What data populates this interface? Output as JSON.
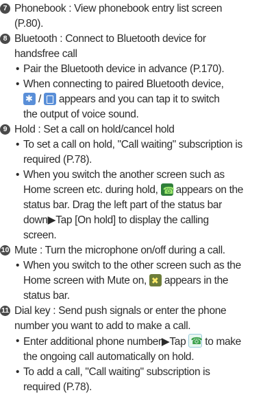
{
  "items": [
    {
      "num": "7",
      "lines": [
        "Phonebook : View phonebook entry list screen",
        "(P.80)."
      ]
    },
    {
      "num": "8",
      "lines": [
        "Bluetooth : Connect to Bluetooth device for",
        "handsfree call"
      ]
    },
    {
      "num": "9",
      "lines": [
        "Hold : Set a call on hold/cancel hold"
      ]
    },
    {
      "num": "10",
      "lines": [
        "Mute : Turn the microphone on/off during a call."
      ]
    },
    {
      "num": "11",
      "lines": [
        "Dial key : Send push signals or enter the phone",
        "number you want to add to make a call."
      ]
    }
  ],
  "bullets": {
    "b1": [
      "Pair the Bluetooth device in advance (P.170)."
    ],
    "b2": [
      "When connecting to paired Bluetooth device,",
      " / ",
      " appears and you can tap it to switch",
      "the output of voice sound."
    ],
    "b3": [
      "To set a call on hold, \"Call waiting\" subscription is",
      "required (P.78)."
    ],
    "b4": [
      "When you switch the another screen such as",
      "Home screen etc. during hold,",
      " appears on the",
      "status bar. Drag the left part of the status bar",
      "down▶Tap [On hold] to display the calling",
      "screen."
    ],
    "b5": [
      "When you switch to the other screen such as the",
      "Home screen with Mute on,",
      " appears in the",
      "status bar."
    ],
    "b6": [
      "Enter additional phone number▶Tap",
      " to make",
      "the ongoing call automatically on hold."
    ],
    "b7": [
      "To add a call, \"Call waiting\" subscription is",
      "required (P.78)."
    ]
  },
  "icons": {
    "bluetooth": "bluetooth-audio-icon",
    "device": "device-audio-icon",
    "hold": "call-on-hold-icon",
    "mute": "mic-muted-icon",
    "call": "add-call-icon"
  }
}
